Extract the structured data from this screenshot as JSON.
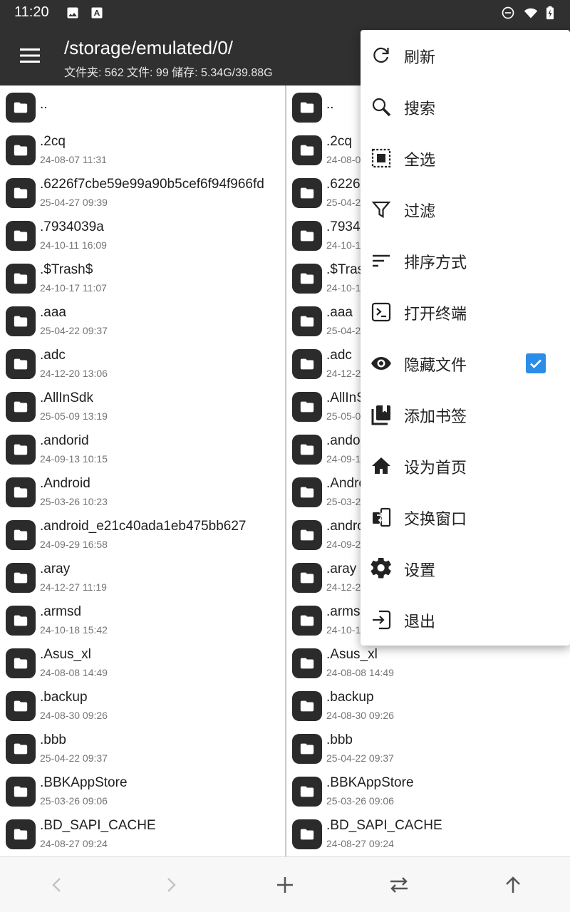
{
  "status_bar": {
    "time": "11:20",
    "left_icons": [
      "image-icon",
      "text-a-icon"
    ],
    "right_icons": [
      "do-not-disturb-icon",
      "wifi-icon",
      "battery-charging-icon"
    ]
  },
  "app_bar": {
    "path": "/storage/emulated/0/",
    "summary": "文件夹: 562  文件: 99  储存: 5.34G/39.88G"
  },
  "left_pane": {
    "items": [
      {
        "name": "..",
        "date": ""
      },
      {
        "name": ".2cq",
        "date": "24-08-07 11:31"
      },
      {
        "name": ".6226f7cbe59e99a90b5cef6f94f966fd",
        "date": "25-04-27 09:39"
      },
      {
        "name": ".7934039a",
        "date": "24-10-11 16:09"
      },
      {
        "name": ".$Trash$",
        "date": "24-10-17 11:07"
      },
      {
        "name": ".aaa",
        "date": "25-04-22 09:37"
      },
      {
        "name": ".adc",
        "date": "24-12-20 13:06"
      },
      {
        "name": ".AllInSdk",
        "date": "25-05-09 13:19"
      },
      {
        "name": ".andorid",
        "date": "24-09-13 10:15"
      },
      {
        "name": ".Android",
        "date": "25-03-26 10:23"
      },
      {
        "name": ".android_e21c40ada1eb475bb627",
        "date": "24-09-29 16:58"
      },
      {
        "name": ".aray",
        "date": "24-12-27 11:19"
      },
      {
        "name": ".armsd",
        "date": "24-10-18 15:42"
      },
      {
        "name": ".Asus_xl",
        "date": "24-08-08 14:49"
      },
      {
        "name": ".backup",
        "date": "24-08-30 09:26"
      },
      {
        "name": ".bbb",
        "date": "25-04-22 09:37"
      },
      {
        "name": ".BBKAppStore",
        "date": "25-03-26 09:06"
      },
      {
        "name": ".BD_SAPI_CACHE",
        "date": "24-08-27 09:24"
      }
    ]
  },
  "right_pane": {
    "items": [
      {
        "name": "..",
        "date": ""
      },
      {
        "name": ".2cq",
        "date": "24-08-0"
      },
      {
        "name": ".6226",
        "date": "25-04-2"
      },
      {
        "name": ".7934",
        "date": "24-10-1"
      },
      {
        "name": ".$Tras",
        "date": "24-10-1"
      },
      {
        "name": ".aaa",
        "date": "25-04-2"
      },
      {
        "name": ".adc",
        "date": "24-12-2"
      },
      {
        "name": ".AllInS",
        "date": "25-05-0"
      },
      {
        "name": ".andor",
        "date": "24-09-1"
      },
      {
        "name": ".Andro",
        "date": "25-03-2"
      },
      {
        "name": ".andro",
        "date": "24-09-2"
      },
      {
        "name": ".aray",
        "date": "24-12-2"
      },
      {
        "name": ".armsd",
        "date": "24-10-1"
      },
      {
        "name": ".Asus_xl",
        "date": "24-08-08 14:49"
      },
      {
        "name": ".backup",
        "date": "24-08-30 09:26"
      },
      {
        "name": ".bbb",
        "date": "25-04-22 09:37"
      },
      {
        "name": ".BBKAppStore",
        "date": "25-03-26 09:06"
      },
      {
        "name": ".BD_SAPI_CACHE",
        "date": "24-08-27 09:24"
      }
    ]
  },
  "menu": {
    "items": [
      {
        "label": "刷新",
        "icon": "refresh-icon"
      },
      {
        "label": "搜索",
        "icon": "search-icon"
      },
      {
        "label": "全选",
        "icon": "select-all-icon"
      },
      {
        "label": "过滤",
        "icon": "filter-icon"
      },
      {
        "label": "排序方式",
        "icon": "sort-icon"
      },
      {
        "label": "打开终端",
        "icon": "terminal-icon"
      },
      {
        "label": "隐藏文件",
        "icon": "eye-icon",
        "checked": true
      },
      {
        "label": "添加书签",
        "icon": "bookmarks-icon"
      },
      {
        "label": "设为首页",
        "icon": "home-icon"
      },
      {
        "label": "交换窗口",
        "icon": "swap-window-icon"
      },
      {
        "label": "设置",
        "icon": "gear-icon"
      },
      {
        "label": "退出",
        "icon": "exit-icon"
      }
    ]
  },
  "bottom_bar": {
    "icons": [
      "chevron-left-icon",
      "chevron-right-icon",
      "plus-icon",
      "swap-icon",
      "arrow-up-icon"
    ]
  },
  "colors": {
    "bar_background": "#303030",
    "checkbox_accent": "#2b8de8",
    "folder_icon": "#2b2b2b"
  }
}
